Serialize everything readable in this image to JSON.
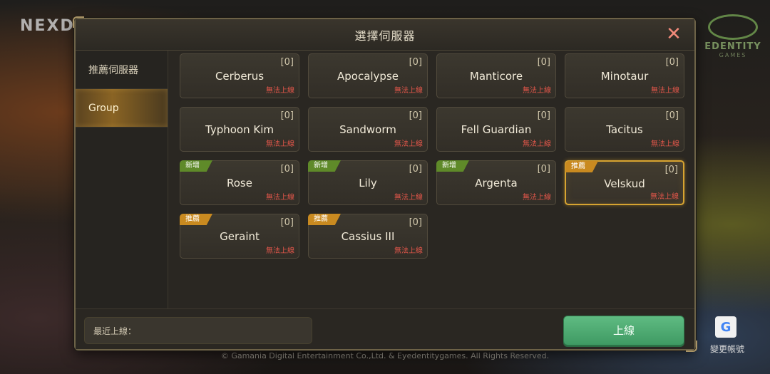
{
  "background": {
    "logo_left": "NEXD",
    "logo_right_text": "EDENTITY",
    "logo_right_sub": "GAMES",
    "copyright": "© Gamania Digital Entertainment Co.,Ltd. & Eyedentitygames. All Rights Reserved.",
    "switch_account": "變更帳號",
    "google_icon": "G"
  },
  "dialog": {
    "title": "選擇伺服器",
    "close_icon": "✕"
  },
  "sidebar": {
    "items": [
      {
        "label": "推薦伺服器",
        "active": false
      },
      {
        "label": "Group",
        "active": true
      }
    ]
  },
  "servers": [
    {
      "name": "Cerberus",
      "count": "[0]",
      "status": "無法上線",
      "badge": ""
    },
    {
      "name": "Apocalypse",
      "count": "[0]",
      "status": "無法上線",
      "badge": ""
    },
    {
      "name": "Manticore",
      "count": "[0]",
      "status": "無法上線",
      "badge": ""
    },
    {
      "name": "Minotaur",
      "count": "[0]",
      "status": "無法上線",
      "badge": ""
    },
    {
      "name": "Typhoon Kim",
      "count": "[0]",
      "status": "無法上線",
      "badge": ""
    },
    {
      "name": "Sandworm",
      "count": "[0]",
      "status": "無法上線",
      "badge": ""
    },
    {
      "name": "Fell Guardian",
      "count": "[0]",
      "status": "無法上線",
      "badge": ""
    },
    {
      "name": "Tacitus",
      "count": "[0]",
      "status": "無法上線",
      "badge": ""
    },
    {
      "name": "Rose",
      "count": "[0]",
      "status": "無法上線",
      "badge": "新增",
      "badge_type": "new"
    },
    {
      "name": "Lily",
      "count": "[0]",
      "status": "無法上線",
      "badge": "新增",
      "badge_type": "new"
    },
    {
      "name": "Argenta",
      "count": "[0]",
      "status": "無法上線",
      "badge": "新增",
      "badge_type": "new"
    },
    {
      "name": "Velskud",
      "count": "[0]",
      "status": "無法上線",
      "badge": "推薦",
      "badge_type": "rec",
      "selected": true
    },
    {
      "name": "Geraint",
      "count": "[0]",
      "status": "無法上線",
      "badge": "推薦",
      "badge_type": "rec"
    },
    {
      "name": "Cassius III",
      "count": "[0]",
      "status": "無法上線",
      "badge": "推薦",
      "badge_type": "rec"
    }
  ],
  "bottom": {
    "recent_label": "最近上線：",
    "connect_label": "上線"
  },
  "colors": {
    "accent_gold": "#d7a431",
    "offline_red": "#e2564a",
    "connect_green": "#4faa72",
    "badge_new": "#5f8a29",
    "badge_rec": "#c98a20"
  }
}
